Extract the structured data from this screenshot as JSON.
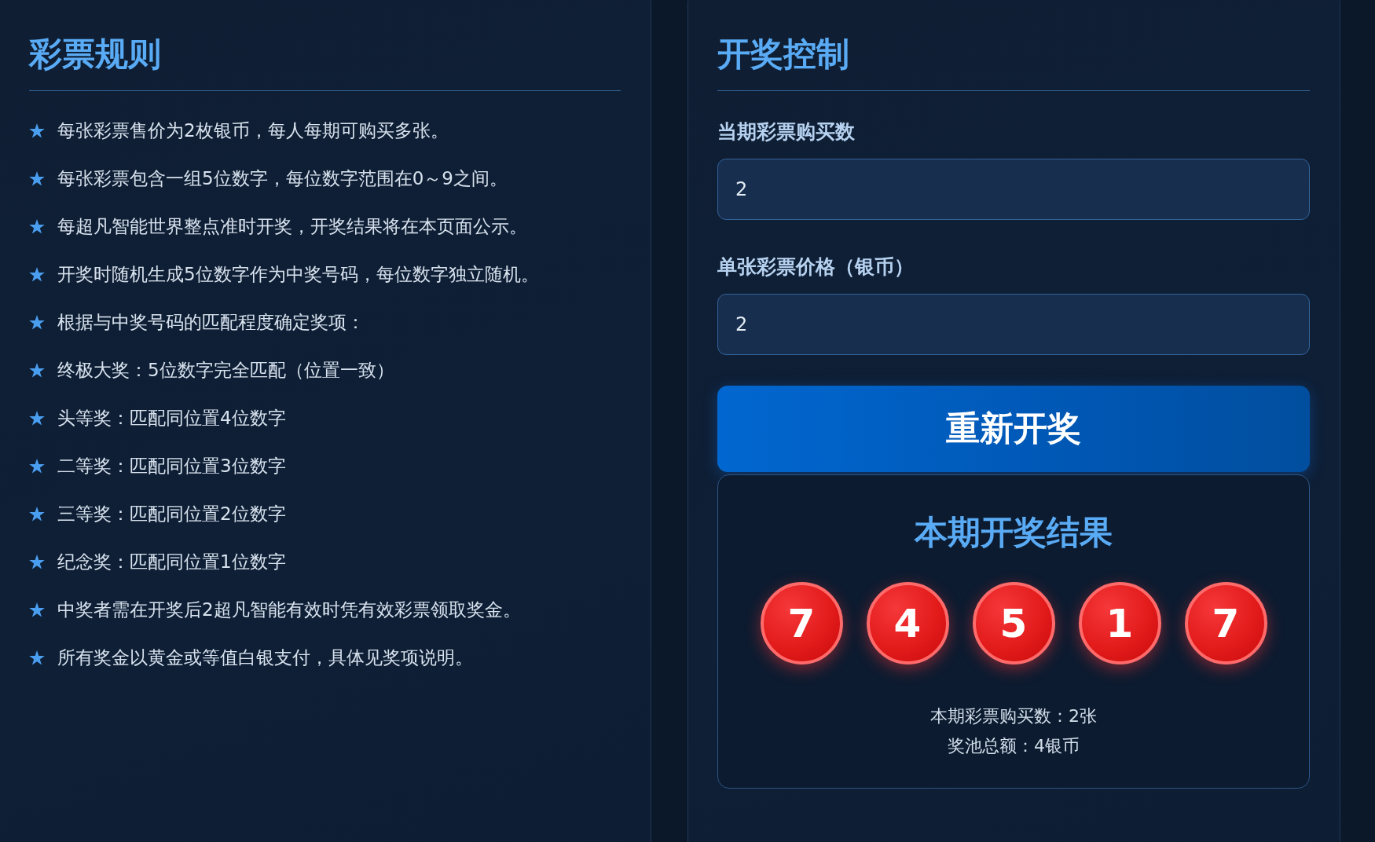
{
  "rules_panel": {
    "title": "彩票规则",
    "rules": [
      "每张彩票售价为2枚银币，每人每期可购买多张。",
      "每张彩票包含一组5位数字，每位数字范围在0～9之间。",
      "每超凡智能世界整点准时开奖，开奖结果将在本页面公示。",
      "开奖时随机生成5位数字作为中奖号码，每位数字独立随机。",
      "根据与中奖号码的匹配程度确定奖项：",
      "终极大奖：5位数字完全匹配（位置一致）",
      "头等奖：匹配同位置4位数字",
      "二等奖：匹配同位置3位数字",
      "三等奖：匹配同位置2位数字",
      "纪念奖：匹配同位置1位数字",
      "中奖者需在开奖后2超凡智能有效时凭有效彩票领取奖金。",
      "所有奖金以黄金或等值白银支付，具体见奖项说明。"
    ]
  },
  "control_panel": {
    "title": "开奖控制",
    "fields": [
      {
        "label": "当期彩票购买数",
        "value": "2"
      },
      {
        "label": "单张彩票价格（银币）",
        "value": "2"
      }
    ],
    "draw_button": "重新开奖",
    "result": {
      "title": "本期开奖结果",
      "numbers": [
        "7",
        "4",
        "5",
        "1",
        "7"
      ],
      "summary": [
        "本期彩票购买数：2张",
        "奖池总额：4银币"
      ]
    }
  }
}
